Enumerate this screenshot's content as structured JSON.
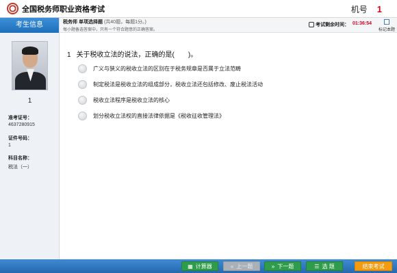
{
  "app": {
    "title": "全国税务师职业资格考试",
    "machine_label": "机号",
    "machine_number": "1"
  },
  "sidebar": {
    "header": "考生信息",
    "seat_number": "1",
    "ticket_label": "准考证号：",
    "ticket_value": "4637280915",
    "id_label": "证件号码：",
    "id_value": "1",
    "subject_label": "科目名称：",
    "subject_value": "税法（一）"
  },
  "question_bar": {
    "type": "税务师 单项选择题",
    "type_sub": "(共40题，每题1分。)",
    "hint": "每小题备选答案中，只有一个符合题意的正确答案。",
    "timer_label": "考试剩余时间：",
    "timer_value": "01:36:54",
    "mark_label": "标记本题"
  },
  "question": {
    "number": "1",
    "text": "关于税收立法的说法，正确的是(　　)。",
    "options": [
      "广义与狭义的税收立法的区别在于税务规章是否属于立法范畴",
      "制定税法是税收立法的组成部分，税收立法还包括修改、废止税法活动",
      "税收立法程序是税收立法的核心",
      "划分税收立法权的直接法律依据是《税收征收管理法》"
    ]
  },
  "toolbar": {
    "calculator": "计算器",
    "prev": "上一题",
    "next": "下一题",
    "select": "选 题",
    "finish": "结束考试"
  },
  "colors": {
    "accent": "#2668ad",
    "timer": "#d0021b",
    "green": "#2f9c4b",
    "orange": "#f39c12"
  }
}
